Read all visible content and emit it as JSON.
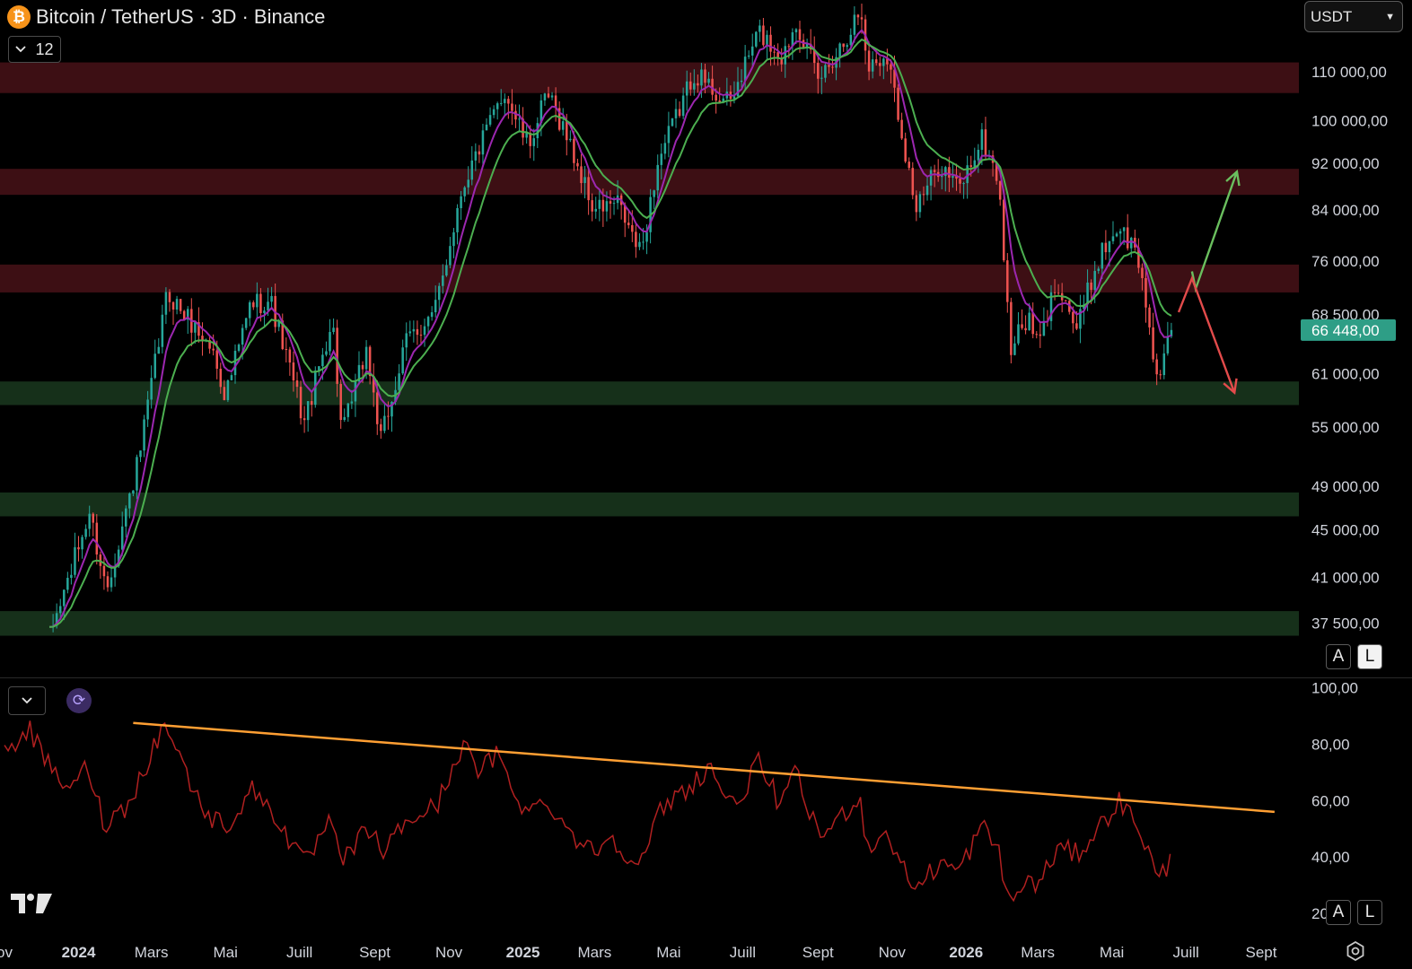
{
  "header": {
    "symbol_title": "Bitcoin / TetherUS · 3D · Binance",
    "logo_glyph": "₿",
    "collapse_count": "12",
    "currency": "USDT"
  },
  "controls": {
    "price_scale": {
      "a": "A",
      "l": "L"
    },
    "rsi_scale": {
      "a": "A",
      "l": "L"
    },
    "refresh_glyph": "⟳"
  },
  "colors": {
    "up": "#26a69a",
    "down": "#ef5350",
    "ma_fast": "#9c27b0",
    "ma_slow": "#4caf50",
    "resistance_zone": "#3d0f14",
    "support_zone": "#16301a",
    "rsi_line": "#b02020",
    "trendline": "#ff9f33",
    "arrow_up": "#6abf5e",
    "arrow_down": "#e34b4b",
    "last_price_bg": "#2e9e86"
  },
  "chart_data": [
    {
      "type": "candlestick",
      "title": "Bitcoin / TetherUS · 3D · Binance",
      "y_scale": "log",
      "ylim": [
        33800,
        126500
      ],
      "y_ticks": [
        {
          "value": 110000,
          "label": "110 000,00"
        },
        {
          "value": 100000,
          "label": "100 000,00"
        },
        {
          "value": 92000,
          "label": "92 000,00"
        },
        {
          "value": 84000,
          "label": "84 000,00"
        },
        {
          "value": 76000,
          "label": "76 000,00"
        },
        {
          "value": 68500,
          "label": "68 500,00"
        },
        {
          "value": 61000,
          "label": "61 000,00"
        },
        {
          "value": 55000,
          "label": "55 000,00"
        },
        {
          "value": 49000,
          "label": "49 000,00"
        },
        {
          "value": 45000,
          "label": "45 000,00"
        },
        {
          "value": 41000,
          "label": "41 000,00"
        },
        {
          "value": 37500,
          "label": "37 500,00"
        }
      ],
      "last_price": {
        "value": 66448,
        "label": "66 448,00"
      },
      "x_ticks": [
        {
          "date": "2023-11-01",
          "label": "ov",
          "bold": false
        },
        {
          "date": "2024-01-01",
          "label": "2024",
          "bold": true
        },
        {
          "date": "2024-03-01",
          "label": "Mars",
          "bold": false
        },
        {
          "date": "2024-05-01",
          "label": "Mai",
          "bold": false
        },
        {
          "date": "2024-07-01",
          "label": "Juill",
          "bold": false
        },
        {
          "date": "2024-09-01",
          "label": "Sept",
          "bold": false
        },
        {
          "date": "2024-11-01",
          "label": "Nov",
          "bold": false
        },
        {
          "date": "2025-01-01",
          "label": "2025",
          "bold": true
        },
        {
          "date": "2025-03-01",
          "label": "Mars",
          "bold": false
        },
        {
          "date": "2025-05-01",
          "label": "Mai",
          "bold": false
        },
        {
          "date": "2025-07-01",
          "label": "Juill",
          "bold": false
        },
        {
          "date": "2025-09-01",
          "label": "Sept",
          "bold": false
        },
        {
          "date": "2025-11-01",
          "label": "Nov",
          "bold": false
        },
        {
          "date": "2026-01-01",
          "label": "2026",
          "bold": true
        },
        {
          "date": "2026-03-01",
          "label": "Mars",
          "bold": false
        },
        {
          "date": "2026-05-01",
          "label": "Mai",
          "bold": false
        },
        {
          "date": "2026-07-01",
          "label": "Juill",
          "bold": false
        },
        {
          "date": "2026-09-01",
          "label": "Sept",
          "bold": false
        }
      ],
      "zones": [
        {
          "kind": "resistance",
          "from": 105500,
          "to": 112000
        },
        {
          "kind": "resistance",
          "from": 86500,
          "to": 91000
        },
        {
          "kind": "resistance",
          "from": 71500,
          "to": 75500
        },
        {
          "kind": "support",
          "from": 57400,
          "to": 60100
        },
        {
          "kind": "support",
          "from": 46200,
          "to": 48400
        },
        {
          "kind": "support",
          "from": 36600,
          "to": 38400
        }
      ],
      "price_path": [
        [
          "2023-12-08",
          36500
        ],
        [
          "2024-01-10",
          46500
        ],
        [
          "2024-01-24",
          40000
        ],
        [
          "2024-02-20",
          51800
        ],
        [
          "2024-03-14",
          71500
        ],
        [
          "2024-04-20",
          64000
        ],
        [
          "2024-05-01",
          58500
        ],
        [
          "2024-05-22",
          70000
        ],
        [
          "2024-06-07",
          70500
        ],
        [
          "2024-07-05",
          55500
        ],
        [
          "2024-07-28",
          68000
        ],
        [
          "2024-08-05",
          54000
        ],
        [
          "2024-08-25",
          64000
        ],
        [
          "2024-09-06",
          53500
        ],
        [
          "2024-09-28",
          65500
        ],
        [
          "2024-10-20",
          68500
        ],
        [
          "2024-11-12",
          88000
        ],
        [
          "2024-12-17",
          106000
        ],
        [
          "2025-01-05",
          95000
        ],
        [
          "2025-01-21",
          105000
        ],
        [
          "2025-02-03",
          99000
        ],
        [
          "2025-02-28",
          84000
        ],
        [
          "2025-03-20",
          85000
        ],
        [
          "2025-04-08",
          77000
        ],
        [
          "2025-04-22",
          92000
        ],
        [
          "2025-05-22",
          110000
        ],
        [
          "2025-06-20",
          103000
        ],
        [
          "2025-07-14",
          119000
        ],
        [
          "2025-08-03",
          113000
        ],
        [
          "2025-08-14",
          122000
        ],
        [
          "2025-09-01",
          108000
        ],
        [
          "2025-09-20",
          116000
        ],
        [
          "2025-10-06",
          124000
        ],
        [
          "2025-10-12",
          111000
        ],
        [
          "2025-10-28",
          114000
        ],
        [
          "2025-11-21",
          84000
        ],
        [
          "2025-12-10",
          92000
        ],
        [
          "2025-12-26",
          87500
        ],
        [
          "2026-01-14",
          96500
        ],
        [
          "2026-01-28",
          89000
        ],
        [
          "2026-02-06",
          64000
        ],
        [
          "2026-02-20",
          68000
        ],
        [
          "2026-03-02",
          64500
        ],
        [
          "2026-03-17",
          73500
        ],
        [
          "2026-04-02",
          66500
        ],
        [
          "2026-04-20",
          76500
        ],
        [
          "2026-05-06",
          81500
        ],
        [
          "2026-05-22",
          77000
        ],
        [
          "2026-06-01",
          67000
        ],
        [
          "2026-06-08",
          60000
        ],
        [
          "2026-06-20",
          66448
        ]
      ],
      "ma_fast_note": "purple moving average",
      "ma_slow_note": "green moving average",
      "projections": [
        {
          "direction": "up",
          "points": [
            [
              "2026-07-06",
              74500
            ],
            [
              "2026-07-09",
              72000
            ],
            [
              "2026-08-12",
              90500
            ]
          ]
        },
        {
          "direction": "down",
          "points": [
            [
              "2026-06-25",
              68800
            ],
            [
              "2026-07-06",
              73500
            ],
            [
              "2026-08-10",
              58800
            ]
          ]
        }
      ]
    },
    {
      "type": "line",
      "ylim": [
        14,
        103
      ],
      "y_ticks": [
        {
          "value": 100,
          "label": "100,00"
        },
        {
          "value": 80,
          "label": "80,00"
        },
        {
          "value": 60,
          "label": "60,00"
        },
        {
          "value": 40,
          "label": "40,00"
        },
        {
          "value": 20,
          "label": "20,00"
        }
      ],
      "series": [
        {
          "values": [
            [
              "2023-11-01",
              76
            ],
            [
              "2023-11-20",
              86
            ],
            [
              "2023-12-10",
              70
            ],
            [
              "2023-12-28",
              64
            ],
            [
              "2024-01-08",
              73
            ],
            [
              "2024-01-22",
              52
            ],
            [
              "2024-02-10",
              58
            ],
            [
              "2024-03-03",
              79
            ],
            [
              "2024-03-13",
              88
            ],
            [
              "2024-04-05",
              63
            ],
            [
              "2024-04-20",
              53
            ],
            [
              "2024-05-05",
              52
            ],
            [
              "2024-05-22",
              64
            ],
            [
              "2024-06-08",
              57
            ],
            [
              "2024-07-05",
              37
            ],
            [
              "2024-07-25",
              52
            ],
            [
              "2024-08-05",
              38
            ],
            [
              "2024-08-28",
              51
            ],
            [
              "2024-09-06",
              41
            ],
            [
              "2024-09-28",
              53
            ],
            [
              "2024-10-22",
              58
            ],
            [
              "2024-11-12",
              80
            ],
            [
              "2024-11-25",
              70
            ],
            [
              "2024-12-10",
              76
            ],
            [
              "2025-01-05",
              55
            ],
            [
              "2025-01-20",
              61
            ],
            [
              "2025-02-03",
              52
            ],
            [
              "2025-02-25",
              42
            ],
            [
              "2025-03-15",
              47
            ],
            [
              "2025-04-08",
              37
            ],
            [
              "2025-04-25",
              57
            ],
            [
              "2025-05-20",
              66
            ],
            [
              "2025-06-05",
              72
            ],
            [
              "2025-06-22",
              57
            ],
            [
              "2025-07-14",
              73
            ],
            [
              "2025-08-02",
              58
            ],
            [
              "2025-08-14",
              70
            ],
            [
              "2025-09-01",
              47
            ],
            [
              "2025-09-15",
              52
            ],
            [
              "2025-10-05",
              62
            ],
            [
              "2025-10-12",
              43
            ],
            [
              "2025-10-28",
              49
            ],
            [
              "2025-11-12",
              34
            ],
            [
              "2025-11-21",
              29
            ],
            [
              "2025-12-10",
              38
            ],
            [
              "2025-12-26",
              35
            ],
            [
              "2026-01-14",
              51
            ],
            [
              "2026-01-28",
              42
            ],
            [
              "2026-02-06",
              23
            ],
            [
              "2026-02-20",
              32
            ],
            [
              "2026-03-02",
              30
            ],
            [
              "2026-03-17",
              43
            ],
            [
              "2026-04-02",
              41
            ],
            [
              "2026-04-20",
              50
            ],
            [
              "2026-05-06",
              60
            ],
            [
              "2026-05-22",
              52
            ],
            [
              "2026-06-01",
              41
            ],
            [
              "2026-06-08",
              31
            ],
            [
              "2026-06-20",
              40
            ]
          ]
        }
      ],
      "trendline": {
        "from": [
          "2024-02-15",
          87.5
        ],
        "to": [
          "2026-09-12",
          56
        ]
      }
    }
  ]
}
